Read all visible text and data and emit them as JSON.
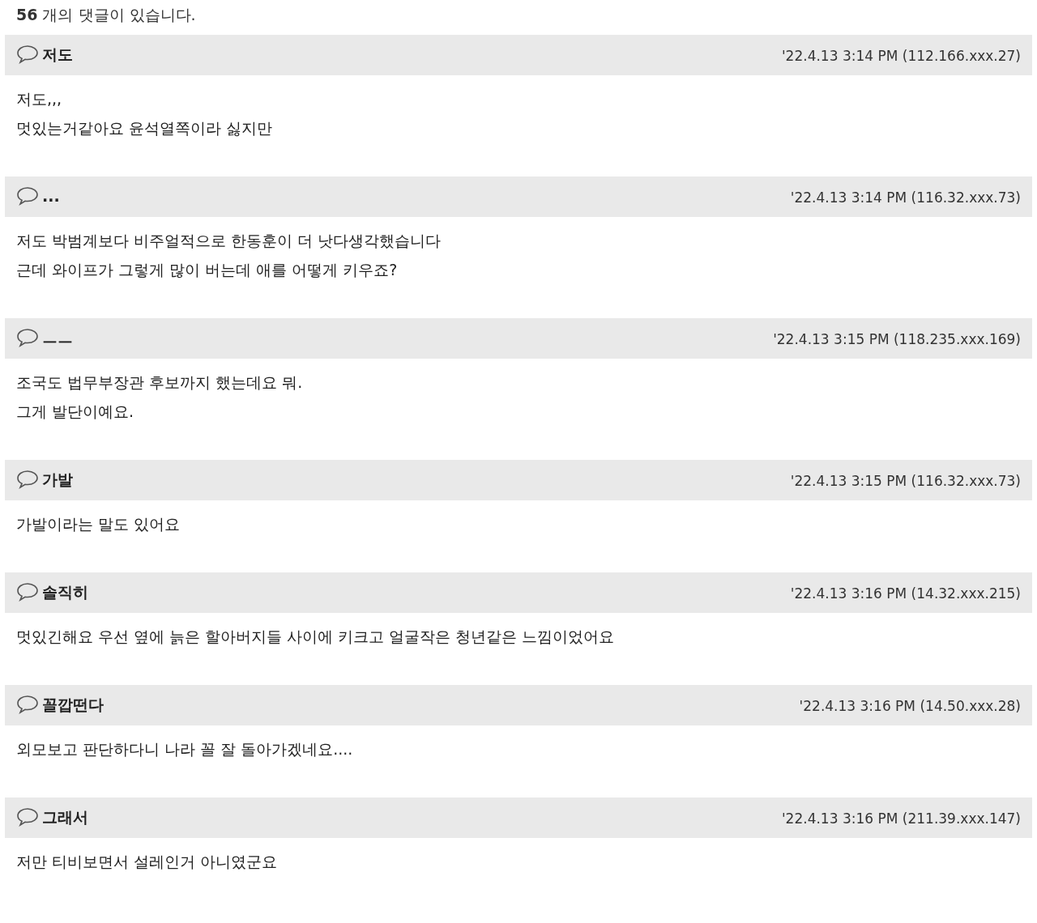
{
  "comment_count": "**56** 개의 댓글이 있습니다.",
  "comments": [
    {
      "author": "저도",
      "date": "'22.4.13 3:14 PM (112.166.xxx.27)",
      "lines": [
        "저도,,,",
        "멋있는거같아요 윤석열쪽이라 싫지만"
      ]
    },
    {
      "author": "...",
      "date": "'22.4.13 3:14 PM (116.32.xxx.73)",
      "lines": [
        "저도 박범계보다 비주얼적으로 한동훈이 더 낫다생각했습니다",
        "근데 와이프가 그렇게 많이 버는데 애를 어떻게 키우죠?"
      ]
    },
    {
      "author": "ㅡㅡ",
      "date": "'22.4.13 3:15 PM (118.235.xxx.169)",
      "lines": [
        "조국도 법무부장관 후보까지 했는데요 뭐.",
        "그게 발단이예요."
      ]
    },
    {
      "author": "가발",
      "date": "'22.4.13 3:15 PM (116.32.xxx.73)",
      "lines": [
        "가발이라는 말도 있어요"
      ]
    },
    {
      "author": "솔직히",
      "date": "'22.4.13 3:16 PM (14.32.xxx.215)",
      "lines": [
        "멋있긴해요 우선 옆에 늙은 할아버지들 사이에 키크고 얼굴작은 청년같은 느낌이었어요"
      ]
    },
    {
      "author": "꼴깝떤다",
      "date": "'22.4.13 3:16 PM (14.50.xxx.28)",
      "lines": [
        "외모보고 판단하다니 나라 꼴 잘 돌아가겠네요...."
      ]
    },
    {
      "author": "그래서",
      "date": "'22.4.13 3:16 PM (211.39.xxx.147)",
      "lines": [
        "저만 티비보면서 설레인거 아니였군요"
      ]
    }
  ]
}
